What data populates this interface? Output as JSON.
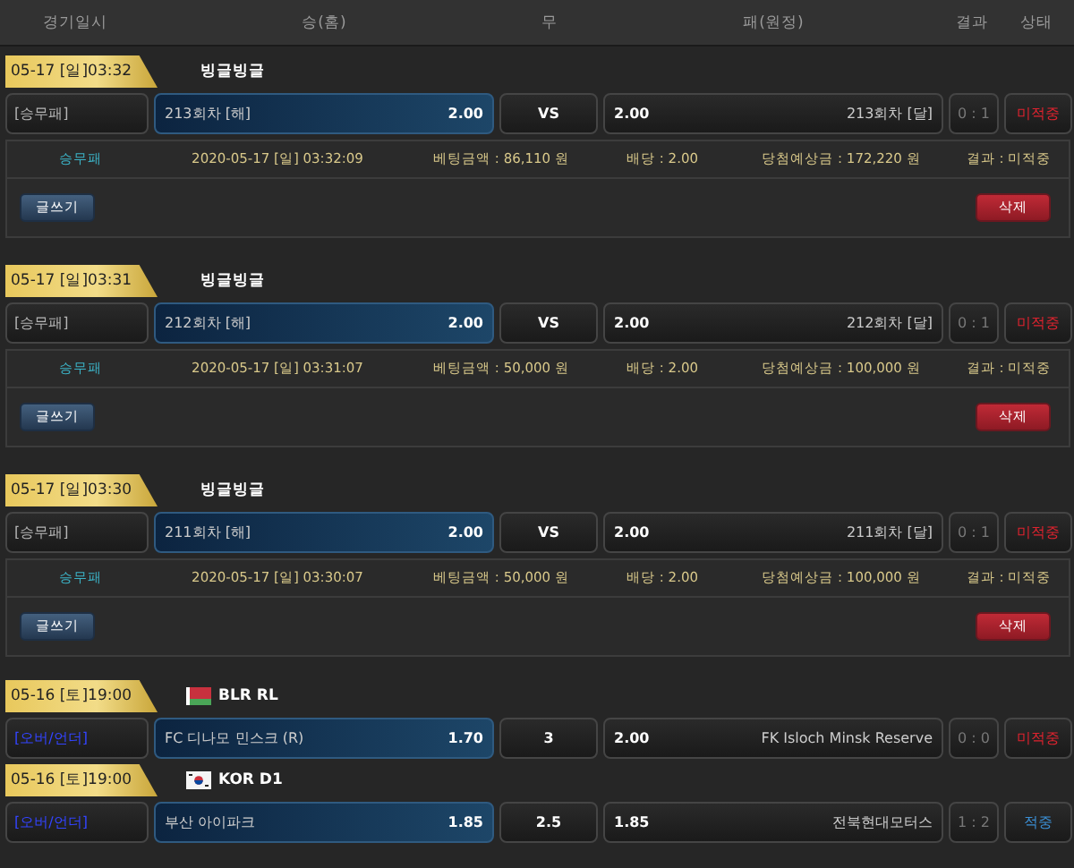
{
  "header": {
    "columns": [
      "경기일시",
      "승(홈)",
      "무",
      "패(원정)",
      "결과",
      "상태"
    ]
  },
  "matches": [
    {
      "date": "05-17 [일]03:32",
      "league": "빙글빙글",
      "bet_type": {
        "text": "[승무패]",
        "kind": "plain"
      },
      "home": {
        "team": "213회차 [해]",
        "odds": "2.00",
        "selected": true
      },
      "draw": "VS",
      "away": {
        "team": "213회차 [달]",
        "odds": "2.00",
        "selected": false
      },
      "score": "0 : 1",
      "status": {
        "text": "미적중",
        "kind": "miss"
      },
      "detail": {
        "bet_type": "승무패",
        "datetime": "2020-05-17 [일] 03:32:09",
        "amount": "베팅금액 : 86,110 원",
        "odds": "배당 : 2.00",
        "expected": "당첨예상금 : 172,220 원",
        "result": "결과 : 미적중",
        "write_button": "글쓰기",
        "delete_button": "삭제"
      }
    },
    {
      "date": "05-17 [일]03:31",
      "league": "빙글빙글",
      "bet_type": {
        "text": "[승무패]",
        "kind": "plain"
      },
      "home": {
        "team": "212회차 [해]",
        "odds": "2.00",
        "selected": true
      },
      "draw": "VS",
      "away": {
        "team": "212회차 [달]",
        "odds": "2.00",
        "selected": false
      },
      "score": "0 : 1",
      "status": {
        "text": "미적중",
        "kind": "miss"
      },
      "detail": {
        "bet_type": "승무패",
        "datetime": "2020-05-17 [일] 03:31:07",
        "amount": "베팅금액 : 50,000 원",
        "odds": "배당 : 2.00",
        "expected": "당첨예상금 : 100,000 원",
        "result": "결과 : 미적중",
        "write_button": "글쓰기",
        "delete_button": "삭제"
      }
    },
    {
      "date": "05-17 [일]03:30",
      "league": "빙글빙글",
      "bet_type": {
        "text": "[승무패]",
        "kind": "plain"
      },
      "home": {
        "team": "211회차 [해]",
        "odds": "2.00",
        "selected": true
      },
      "draw": "VS",
      "away": {
        "team": "211회차 [달]",
        "odds": "2.00",
        "selected": false
      },
      "score": "0 : 1",
      "status": {
        "text": "미적중",
        "kind": "miss"
      },
      "detail": {
        "bet_type": "승무패",
        "datetime": "2020-05-17 [일] 03:30:07",
        "amount": "베팅금액 : 50,000 원",
        "odds": "배당 : 2.00",
        "expected": "당첨예상금 : 100,000 원",
        "result": "결과 : 미적중",
        "write_button": "글쓰기",
        "delete_button": "삭제"
      }
    },
    {
      "date": "05-16 [토]19:00",
      "flag": {
        "kind": "belarus"
      },
      "league": "BLR RL",
      "bet_type": {
        "text": "[오버/언더]",
        "kind": "link"
      },
      "home": {
        "team": "FC 디나모 민스크 (R)",
        "odds": "1.70",
        "selected": true
      },
      "draw": "3",
      "away": {
        "team": "FK Isloch Minsk Reserve",
        "odds": "2.00",
        "selected": false
      },
      "score": "0 : 0",
      "status": {
        "text": "미적중",
        "kind": "miss"
      }
    },
    {
      "date": "05-16 [토]19:00",
      "flag": {
        "kind": "korea"
      },
      "league": "KOR D1",
      "bet_type": {
        "text": "[오버/언더]",
        "kind": "link"
      },
      "home": {
        "team": "부산 아이파크",
        "odds": "1.85",
        "selected": true
      },
      "draw": "2.5",
      "away": {
        "team": "전북현대모터스",
        "odds": "1.85",
        "selected": false
      },
      "score": "1 : 2",
      "status": {
        "text": "적중",
        "kind": "hit"
      }
    }
  ]
}
